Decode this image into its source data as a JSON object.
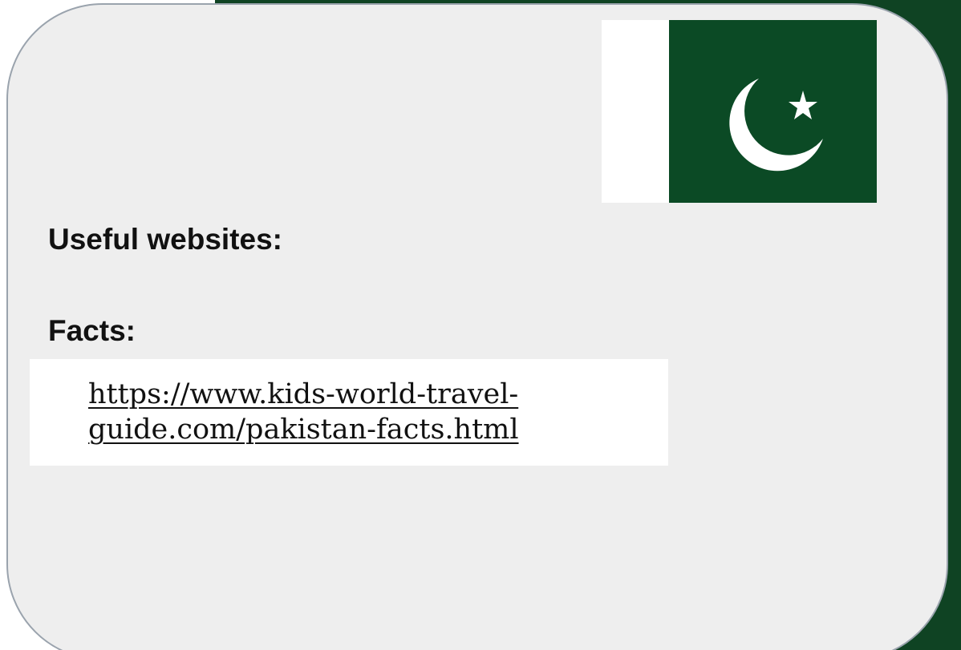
{
  "slide": {
    "useful_websites_heading": "Useful websites:",
    "facts_heading": "Facts:",
    "link_line1": "https://www.kids-world-travel-",
    "link_line2": "guide.com/pakistan-facts.html"
  },
  "flag": {
    "icon": "pakistan-flag-icon",
    "field_color": "#0b4a25",
    "hoist_color": "#ffffff"
  },
  "colors": {
    "background_band": "#0f4323",
    "card": "#eeeeee",
    "card_border": "#9aa3ad"
  }
}
